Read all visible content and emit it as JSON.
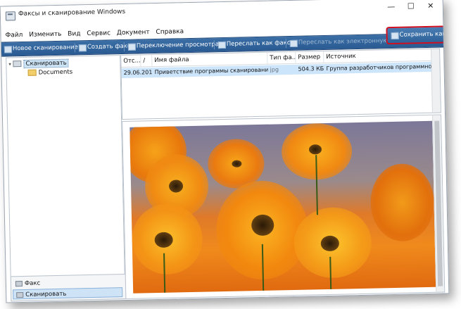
{
  "window": {
    "title": "Факсы и сканирование Windows",
    "controls": {
      "minimize": "—",
      "maximize": "☐",
      "close": "✕"
    }
  },
  "menu": [
    "Файл",
    "Изменить",
    "Вид",
    "Сервис",
    "Документ",
    "Справка"
  ],
  "toolbar": {
    "new_scan": "Новое сканирование",
    "new_fax": "Создать факс",
    "toggle_preview": "Переключение просмотра",
    "forward_fax": "Переслать как факс",
    "forward_email": "Переслать как электронную почту",
    "save_as": "Сохранить как..."
  },
  "tree": {
    "root": "Сканировать",
    "child": "Documents"
  },
  "nav": {
    "fax": "Факс",
    "scan": "Сканировать"
  },
  "table": {
    "columns": [
      "Отс...",
      "/",
      "Имя файла",
      "Тип фа...",
      "Размер",
      "Источник"
    ],
    "rows": [
      {
        "date": "29.06.201...",
        "name": "Приветствие программы сканирования",
        "type": "jpg",
        "size": "504.3 КБ",
        "source": "Группа разработчиков программного ..."
      }
    ]
  },
  "colors": {
    "toolbar": "#2f6299",
    "highlight_border": "#d01020",
    "selected_row": "#cce5fb"
  }
}
